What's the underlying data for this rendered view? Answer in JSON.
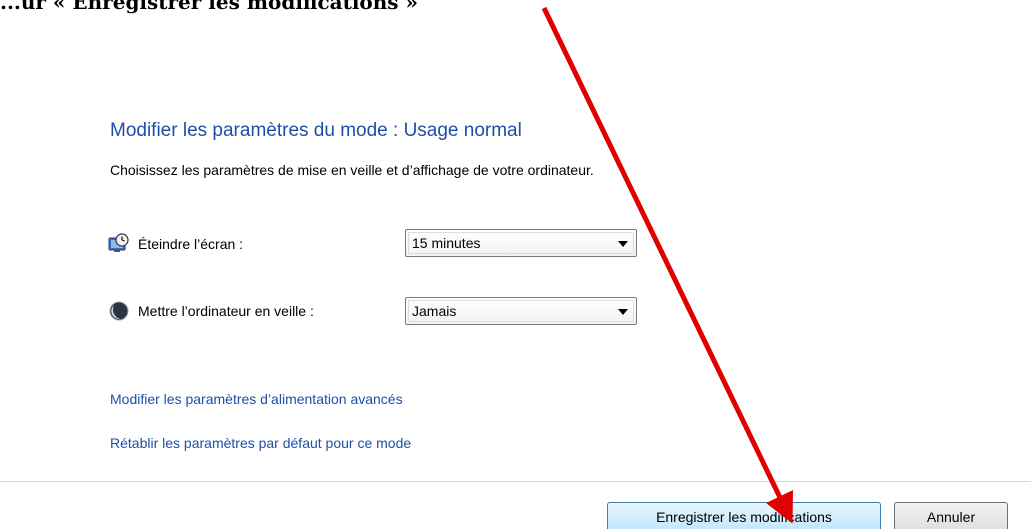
{
  "caption": {
    "text": "...ur « Enregistrer les modifications »"
  },
  "plan": {
    "title": "Modifier les paramètres du mode : Usage normal",
    "subtitle": "Choisissez les paramètres de mise en veille et d’affichage de votre ordinateur."
  },
  "settings": {
    "screen": {
      "icon": "display-clock-icon",
      "label": "Éteindre l’écran :",
      "value": "15 minutes"
    },
    "sleep": {
      "icon": "moon-icon",
      "label": "Mettre l’ordinateur en veille :",
      "value": "Jamais"
    }
  },
  "links": {
    "advanced": "Modifier les paramètres d’alimentation avancés",
    "restore": "Rétablir les paramètres par défaut pour ce mode"
  },
  "buttons": {
    "save": "Enregistrer les modifications",
    "cancel": "Annuler"
  },
  "colors": {
    "link": "#1e4fa8",
    "annotation_arrow": "#e00000"
  }
}
